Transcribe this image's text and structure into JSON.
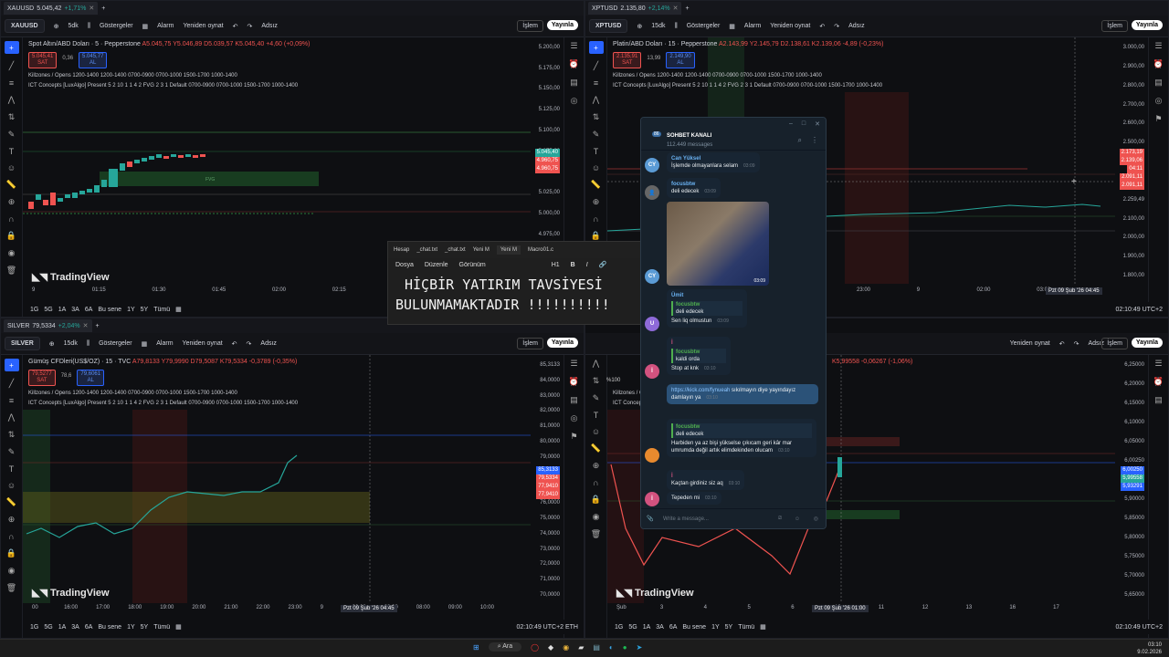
{
  "panes": {
    "tl": {
      "tab": {
        "title": "XAUUSD",
        "price": "5.045,42",
        "change": "+1,71%"
      },
      "symbol": "XAUUSD",
      "interval": "5dk",
      "info": "Spot Altın/ABD Doları · 5 · Pepperstone",
      "ohlc": "A5.045,75 Y5.046,89 D5.039,57 K5.045,40 +4,60 (+0,09%)",
      "sell": {
        "price": "5.045,41",
        "label": "SAT"
      },
      "buy": {
        "price": "5.045,77",
        "label": "AL"
      },
      "spread": "0,36",
      "ind1": "Killzones / Opens 1200-1400 1200-1400 0700-0900 0700-1000 1500-1700 1000-1400",
      "ind2": "ICT Concepts [LuxAlgo] Present 5 2 10 1 1 4 2 FVG 2 3 1 Default 0700-0900 0700-1000 1500-1700 1000-1400",
      "yaxis": [
        "5.200,00",
        "5.175,00",
        "5.150,00",
        "5.125,00",
        "5.100,00",
        "5.075,00",
        "5.050,00",
        "5.025,00",
        "5.000,00",
        "4.975,00",
        "4.950,00",
        "4.925,00"
      ],
      "tags": [
        {
          "v": "5.045,40",
          "c": "#26a69a"
        },
        {
          "v": "4.960,75",
          "c": "#ef5350"
        },
        {
          "v": "4.960,75",
          "c": "#ef5350"
        }
      ],
      "xaxis": [
        "9",
        "01:15",
        "01:30",
        "01:45",
        "02:00",
        "02:15",
        "02:30",
        "02:45"
      ],
      "fvg_label": "FVG"
    },
    "tr": {
      "tab": {
        "title": "XPTUSD",
        "price": "2.135,80",
        "change": "+2,14%"
      },
      "symbol": "XPTUSD",
      "interval": "15dk",
      "info": "Platin/ABD Doları · 15 · Pepperstone",
      "ohlc": "A2.143,99 Y2.145,79 D2.138,61 K2.139,06 -4,89 (-0,23%)",
      "sell": {
        "price": "2.135,91",
        "label": "SAT"
      },
      "buy": {
        "price": "2.149,90",
        "label": "AL"
      },
      "spread": "13,99",
      "ind1": "Killzones / Opens 1200-1400 1200-1400 0700-0900 0700-1000 1500-1700 1000-1400",
      "ind2": "ICT Concepts [LuxAlgo] Present 5 2 10 1 1 4 2 FVG 2 3 1 Default 0700-0900 0700-1000 1500-1700 1000-1400",
      "yaxis": [
        "3.000,00",
        "2.900,00",
        "2.800,00",
        "2.700,00",
        "2.600,00",
        "2.500,00",
        "2.400,00",
        "2.300,00",
        "2.259,49",
        "2.100,00",
        "2.000,00",
        "1.900,00",
        "1.800,00"
      ],
      "tags": [
        {
          "v": "2.173,19",
          "c": "#ef5350"
        },
        {
          "v": "2.139,06",
          "c": "#ef5350"
        },
        {
          "v": "04:11",
          "c": "#ef5350"
        },
        {
          "v": "2.091,11",
          "c": "#ef5350"
        },
        {
          "v": "2.091,11",
          "c": "#ef5350"
        }
      ],
      "xaxis": [
        "19:00",
        "20:00",
        "21:00",
        "22:00",
        "23:00",
        "9",
        "02:00",
        "03:00"
      ],
      "cursor_date": "Pzt 09 Şub '26",
      "cursor_time": "04:45",
      "clock": "02:10:49 UTC+2"
    },
    "bl": {
      "tab": {
        "title": "SILVER",
        "price": "79,5334",
        "change": "+2,04%"
      },
      "symbol": "SILVER",
      "interval": "15dk",
      "info": "Gümüş CFDleri(US$/OZ) · 15 · TVC",
      "ohlc": "A79,8133 Y79,9990 D79,5087 K79,5334 -0,3789 (-0,35%)",
      "sell": {
        "price": "79,5277",
        "label": "SAT"
      },
      "buy": {
        "price": "79,6061",
        "label": "AL"
      },
      "spread": "78,6",
      "ind1": "Killzones / Opens 1200-1400 1200-1400 0700-0900 0700-1000 1500-1700 1000-1400",
      "ind2": "ICT Concepts [LuxAlgo] Present 5 2 10 1 1 4 2 FVG 2 3 1 Default 0700-0900 0700-1000 1500-1700 1000-1400",
      "yaxis": [
        "85,3133",
        "84,0000",
        "83,0000",
        "82,0000",
        "81,0000",
        "80,0000",
        "79,0000",
        "78,0000",
        "77,0000",
        "76,0000",
        "75,0000",
        "74,0000",
        "73,0000",
        "72,0000",
        "71,0000",
        "70,0000"
      ],
      "tags": [
        {
          "v": "85,3133",
          "c": "#2962ff"
        },
        {
          "v": "79,5334",
          "c": "#ef5350"
        },
        {
          "v": "77,9410",
          "c": "#ef5350"
        },
        {
          "v": "77,9410",
          "c": "#ef5350"
        }
      ],
      "xaxis": [
        "00",
        "16:00",
        "17:00",
        "18:00",
        "19:00",
        "20:00",
        "21:00",
        "22:00",
        "23:00",
        "9",
        "02:00",
        "03:00",
        "08:00",
        "09:00",
        "10:00"
      ],
      "cursor_date": "Pzt 09 Şub '26",
      "cursor_time": "04:45",
      "clock": "02:10:49 UTC+2",
      "session": "ETH"
    },
    "br": {
      "ohlc": "K5,99558 -0,06267 (-1,06%)",
      "ind1": "Killzones / Opens",
      "ind2": "ICT Concepts",
      "yaxis": [
        "6,25000",
        "6,20000",
        "6,15000",
        "6,10000",
        "6,05000",
        "6,00250",
        "5,95000",
        "5,90000",
        "5,85000",
        "5,80000",
        "5,75000",
        "5,70000",
        "5,65000"
      ],
      "tags": [
        {
          "v": "6,00250",
          "c": "#2962ff"
        },
        {
          "v": "5,99558",
          "c": "#26a69a"
        },
        {
          "v": "5,93291",
          "c": "#2962ff"
        }
      ],
      "xaxis": [
        "Şub",
        "3",
        "4",
        "5",
        "6",
        "10",
        "11",
        "12",
        "13",
        "16",
        "17"
      ],
      "cursor_date": "Pzt 09 Şub '26",
      "cursor_time": "01:00",
      "clock": "02:10:49 UTC+2"
    }
  },
  "toolbar": {
    "indicators": "Göstergeler",
    "alert": "Alarm",
    "replay": "Yeniden oynat",
    "unnamed": "Adsız",
    "trade": "İşlem",
    "publish": "Yayınla"
  },
  "bottom_bar": {
    "ranges": [
      "1G",
      "5G",
      "1A",
      "3A",
      "6A",
      "Bu sene",
      "1Y",
      "5Y",
      "Tümü"
    ]
  },
  "brand": "TradingView",
  "notepad": {
    "tabs": [
      "Hesap",
      "_chat.txt",
      "_chat.txt",
      "Yeni M",
      "Yeni M",
      "Macro01.c"
    ],
    "menu": [
      "Dosya",
      "Düzenle",
      "Görünüm"
    ],
    "heading": "H1",
    "line1": "HİÇBİR YATIRIM TAVSİYESİ",
    "line2": "BULUNMAMAKTADIR !!!!!!!!!!",
    "zoom": "%100"
  },
  "chat": {
    "badge": "86",
    "title": "SOHBET KANALI",
    "subtitle": "112.449 messages",
    "messages": [
      {
        "avatar": "CY",
        "color": "#5b9bd5",
        "name": "Can Yüksel",
        "text": "İşlemde olmayanlara selam",
        "time": "03:09"
      },
      {
        "avatar": "",
        "color": "#666",
        "name": "focusbtw",
        "text": "deli edecek",
        "time": "03:09"
      },
      {
        "avatar": "CY",
        "color": "#5b9bd5",
        "name": "",
        "text": "",
        "time": "03:09"
      },
      {
        "avatar": "U",
        "color": "#8e6ad8",
        "name": "Ümit",
        "quote_name": "focusbtw",
        "quote_text": "deli edecek",
        "text": "Sen liq olmustun",
        "time": "03:09"
      },
      {
        "avatar": "İ",
        "color": "#d2527f",
        "name": "İ",
        "quote_name": "focusbtw",
        "quote_text": "kaldi orda",
        "text": "Stop at knk",
        "time": "03:10"
      },
      {
        "avatar": "",
        "color": "",
        "name": "",
        "link": "https://kick.com/fynueah",
        "text": " sıkılmayın diye yayındayız damlayın ya",
        "time": "03:10"
      },
      {
        "avatar": "",
        "color": "#e88a2e",
        "name": "",
        "quote_name": "focusbtw",
        "quote_text": "deli edecek",
        "text": "Harbiden ya az bişi yükselse çıkıcam geri kâr mar umrumda değil artık elimdekinden olucam",
        "time": "03:10"
      },
      {
        "avatar": "",
        "color": "",
        "name": "İ",
        "text": "Kaçtan girdiniz siz aq",
        "time": "03:10"
      },
      {
        "avatar": "İ",
        "color": "#d2527f",
        "name": "",
        "text": "Tepeden mi",
        "time": "03:10"
      }
    ],
    "input_placeholder": "Write a message..."
  },
  "taskbar": {
    "search": "Ara",
    "time": "03:10",
    "date": "9.02.2026"
  }
}
